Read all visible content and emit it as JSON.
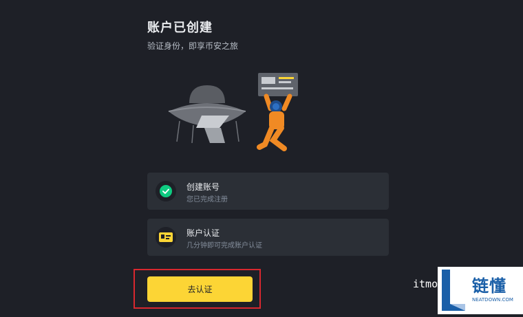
{
  "header": {
    "title": "账户已创建",
    "subtitle": "验证身份，即享币安之旅"
  },
  "steps": [
    {
      "title": "创建账号",
      "description": "您已完成注册",
      "icon": "check-circle-icon",
      "status": "done"
    },
    {
      "title": "账户认证",
      "description": "几分钟即可完成账户认证",
      "icon": "id-card-icon",
      "status": "pending"
    }
  ],
  "action": {
    "label": "去认证"
  },
  "watermark": {
    "site_prefix": "itmo",
    "brand_cn": "链懂",
    "brand_en": "NEATDOWN.COM"
  },
  "colors": {
    "background": "#1e2027",
    "card": "#2b2f36",
    "accent": "#fcd535",
    "success": "#0ecb81",
    "highlight": "#d9282f",
    "astronaut": "#f08a24"
  }
}
